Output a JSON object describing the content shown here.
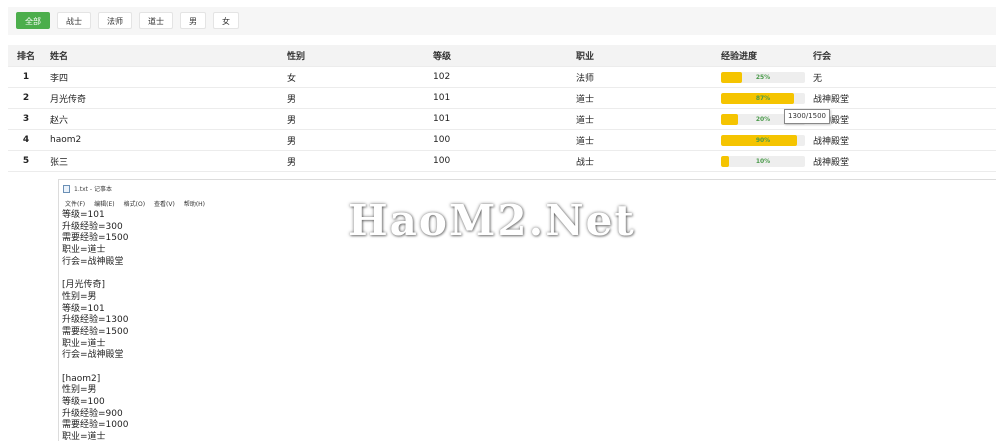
{
  "filters": [
    "全部",
    "战士",
    "法师",
    "道士",
    "男",
    "女"
  ],
  "table": {
    "headers": [
      "排名",
      "姓名",
      "性别",
      "等级",
      "职业",
      "经验进度",
      "行会"
    ],
    "rows": [
      {
        "rank": "1",
        "name": "李四",
        "gender": "女",
        "level": "102",
        "job": "法师",
        "exp": "25%",
        "exp_pct": 25,
        "guild": "无"
      },
      {
        "rank": "2",
        "name": "月光传奇",
        "gender": "男",
        "level": "101",
        "job": "道士",
        "exp": "87%",
        "exp_pct": 87,
        "guild": "战神殿堂"
      },
      {
        "rank": "3",
        "name": "赵六",
        "gender": "男",
        "level": "101",
        "job": "道士",
        "exp": "20%",
        "exp_pct": 20,
        "guild": "战神殿堂"
      },
      {
        "rank": "4",
        "name": "haom2",
        "gender": "男",
        "level": "100",
        "job": "道士",
        "exp": "90%",
        "exp_pct": 90,
        "guild": "战神殿堂"
      },
      {
        "rank": "5",
        "name": "张三",
        "gender": "男",
        "level": "100",
        "job": "战士",
        "exp": "10%",
        "exp_pct": 10,
        "guild": "战神殿堂"
      }
    ]
  },
  "tooltip": "1300/1500",
  "notepad": {
    "title": "1.txt - 记事本",
    "menu": [
      "文件(F)",
      "编辑(E)",
      "格式(O)",
      "查看(V)",
      "帮助(H)"
    ],
    "lines": [
      "等级=101",
      "升级经验=300",
      "需要经验=1500",
      "职业=道士",
      "行会=战神殿堂",
      "",
      "[月光传奇]",
      "性别=男",
      "等级=101",
      "升级经验=1300",
      "需要经验=1500",
      "职业=道士",
      "行会=战神殿堂",
      "",
      "[haom2]",
      "性别=男",
      "等级=100",
      "升级经验=900",
      "需要经验=1000",
      "职业=道士"
    ]
  },
  "watermark": "HaoM2.Net",
  "colors": {
    "accent_green": "#4cae4c",
    "progress_yellow": "#f5c400",
    "progress_text": "#4a9a4a"
  }
}
